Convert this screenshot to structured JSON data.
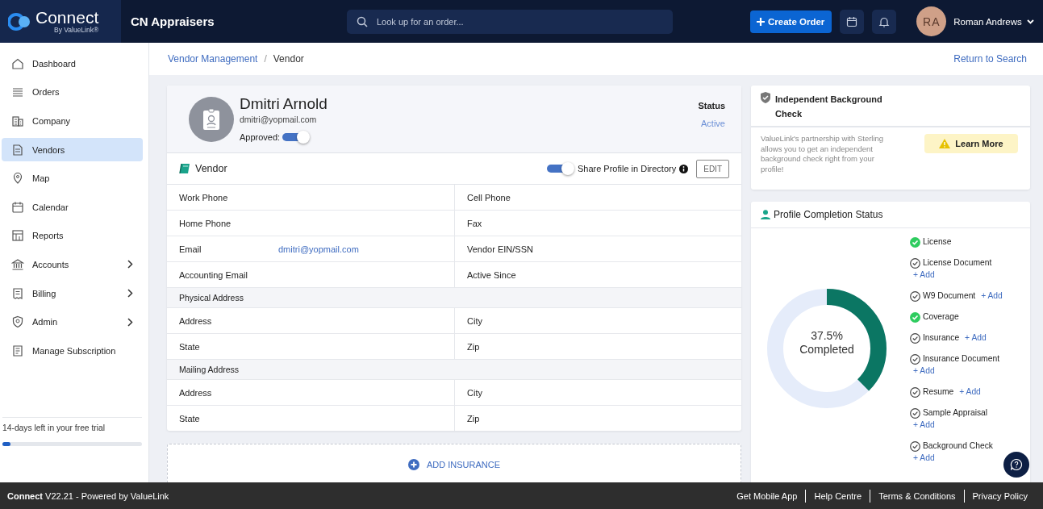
{
  "header": {
    "logo": {
      "name": "Connect",
      "tagline": "By ValueLink®"
    },
    "organization": "CN Appraisers",
    "search": {
      "placeholder": "Look up for an order..."
    },
    "create_button": "Create Order",
    "user": {
      "initials": "RA",
      "name": "Roman Andrews"
    }
  },
  "sidebar": {
    "items": [
      {
        "label": "Dashboard",
        "selected": false,
        "submenu": false
      },
      {
        "label": "Orders",
        "selected": false,
        "submenu": false
      },
      {
        "label": "Company",
        "selected": false,
        "submenu": false
      },
      {
        "label": "Vendors",
        "selected": true,
        "submenu": false
      },
      {
        "label": "Map",
        "selected": false,
        "submenu": false
      },
      {
        "label": "Calendar",
        "selected": false,
        "submenu": false
      },
      {
        "label": "Reports",
        "selected": false,
        "submenu": false
      },
      {
        "label": "Accounts",
        "selected": false,
        "submenu": true
      },
      {
        "label": "Billing",
        "selected": false,
        "submenu": true
      },
      {
        "label": "Admin",
        "selected": false,
        "submenu": true
      },
      {
        "label": "Manage Subscription",
        "selected": false,
        "submenu": false
      }
    ],
    "trial": {
      "text": "14-days left in your free trial",
      "level": 0.06
    }
  },
  "breadcrumb": {
    "items": [
      "Vendor Management",
      "Vendor"
    ],
    "separator": "/",
    "return_link": "Return to Search"
  },
  "vendor": {
    "name": "Dmitri Arnold",
    "email": "dmitri@yopmail.com",
    "approved_label": "Approved:",
    "approved": true,
    "status_label": "Status",
    "status": "Active",
    "section_title": "Vendor",
    "share_label": "Share Profile in Directory",
    "share": true,
    "edit_button": "EDIT",
    "rows": [
      {
        "kind": "fields",
        "cells": [
          {
            "label": "Work Phone"
          },
          {
            "label": "Cell Phone"
          }
        ]
      },
      {
        "kind": "fields",
        "cells": [
          {
            "label": "Home Phone"
          },
          {
            "label": "Fax"
          }
        ]
      },
      {
        "kind": "fields",
        "cells": [
          {
            "label": "Email",
            "value": "dmitri@yopmail.com"
          },
          {
            "label": "Vendor EIN/SSN"
          }
        ]
      },
      {
        "kind": "fields",
        "cells": [
          {
            "label": "Accounting Email"
          },
          {
            "label": "Active Since"
          }
        ]
      },
      {
        "kind": "heading",
        "label": "Physical Address"
      },
      {
        "kind": "fields",
        "cells": [
          {
            "label": "Address"
          },
          {
            "label": "City"
          }
        ]
      },
      {
        "kind": "fields",
        "cells": [
          {
            "label": "State"
          },
          {
            "label": "Zip"
          }
        ]
      },
      {
        "kind": "heading",
        "label": "Mailing Address"
      },
      {
        "kind": "fields",
        "cells": [
          {
            "label": "Address"
          },
          {
            "label": "City"
          }
        ]
      },
      {
        "kind": "fields",
        "cells": [
          {
            "label": "State"
          },
          {
            "label": "Zip"
          }
        ]
      }
    ],
    "add_insurance": "ADD INSURANCE"
  },
  "background_check": {
    "title": "Independent Background Check",
    "text": "ValueLink's partnership with Sterling allows you to get an independent background check right from your profile!",
    "button": "Learn More"
  },
  "completion": {
    "title": "Profile Completion Status",
    "level": 0.375,
    "percent": "37.5%",
    "caption": "Completed",
    "items": [
      {
        "label": "License",
        "checked": true
      },
      {
        "label": "License Document",
        "checked": false,
        "add": "+ Add"
      },
      {
        "label": "W9 Document",
        "checked": false,
        "add": "+ Add"
      },
      {
        "label": "Coverage",
        "checked": true
      },
      {
        "label": "Insurance",
        "checked": false,
        "add": "+ Add"
      },
      {
        "label": "Insurance Document",
        "checked": false,
        "add": "+ Add"
      },
      {
        "label": "Resume",
        "checked": false,
        "add": "+ Add"
      },
      {
        "label": "Sample Appraisal",
        "checked": false,
        "add": "+ Add"
      },
      {
        "label": "Background Check",
        "checked": false,
        "add": "+ Add"
      }
    ]
  },
  "footer": {
    "version": "**Connect** V22.21 - Powered by ValueLink",
    "links": [
      "Get Mobile App",
      "Help Centre",
      "Terms & Conditions",
      "Privacy Policy"
    ]
  }
}
